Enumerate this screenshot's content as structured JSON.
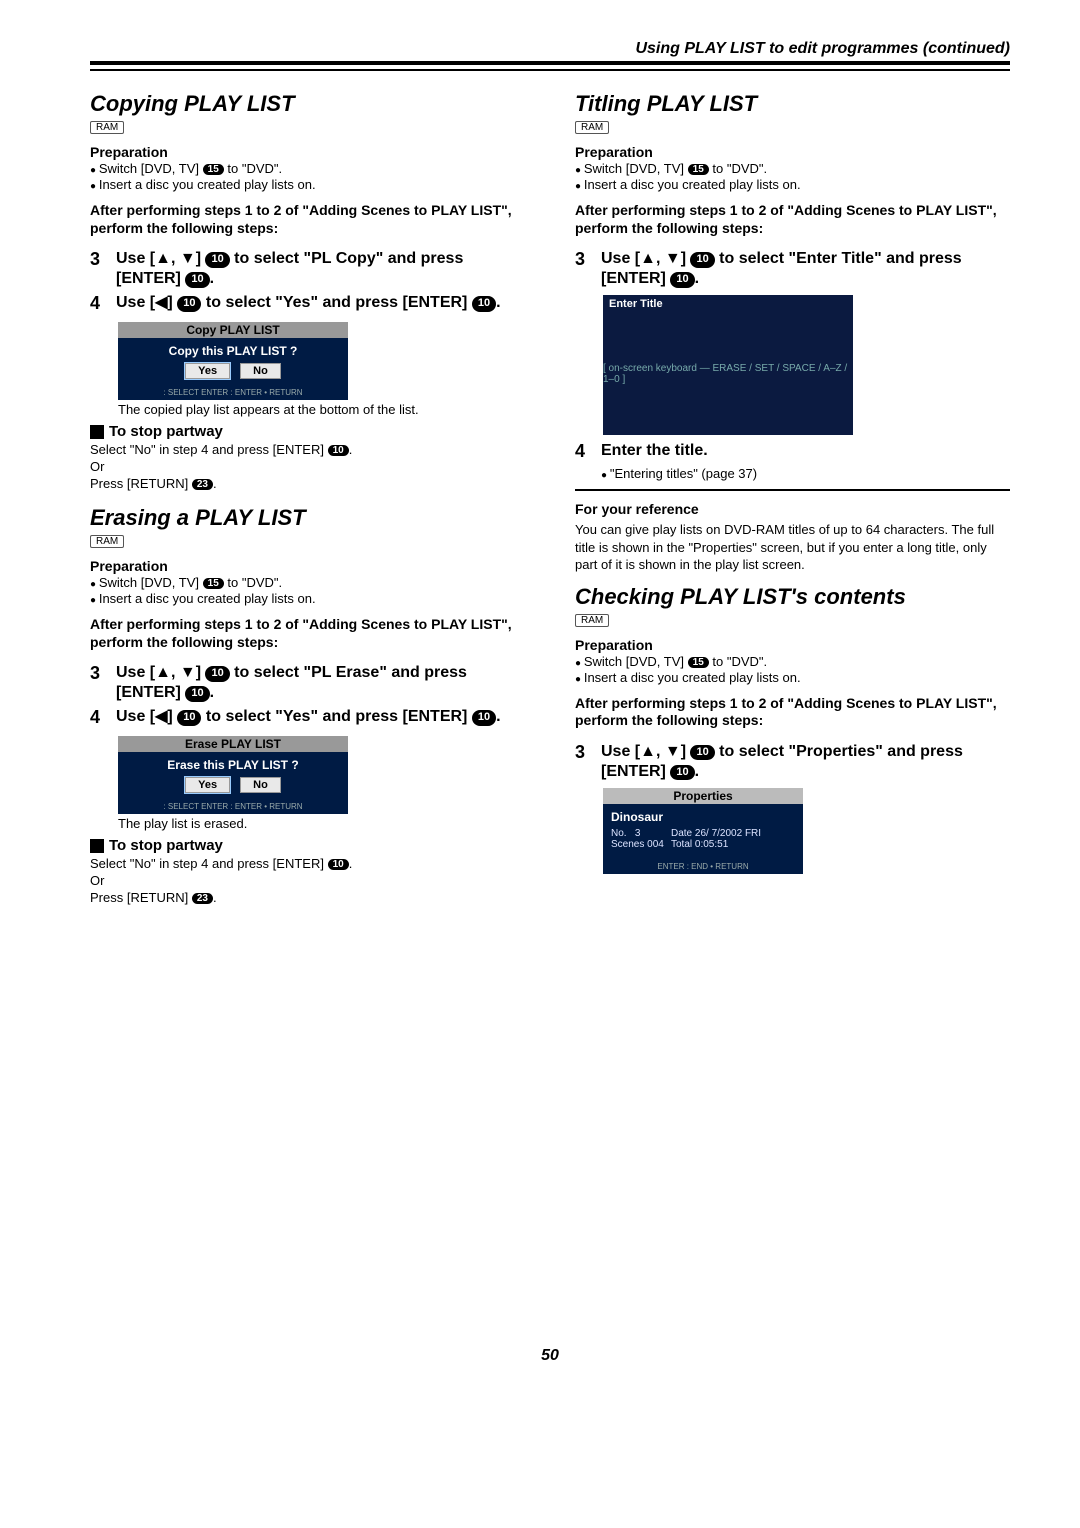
{
  "header": "Using PLAY LIST to edit programmes (continued)",
  "page_number": "50",
  "ram": "RAM",
  "prep_label": "Preparation",
  "prep1_a": "Switch [DVD, TV]",
  "prep1_badge": "15",
  "prep1_b": " to \"DVD\".",
  "prep2": "Insert a disc you created play lists on.",
  "after_steps": "After performing steps 1 to 2 of \"Adding Scenes to PLAY LIST\", perform the following steps:",
  "left": {
    "copy": {
      "title": "Copying PLAY LIST",
      "s3_a": "Use [▲, ▼] ",
      "s3_b": " to select \"PL Copy\" and press [ENTER] ",
      "s4_a": "Use [◀] ",
      "s4_b": " to select \"Yes\" and press [ENTER] ",
      "dlg_title": "Copy PLAY LIST",
      "dlg_msg": "Copy this PLAY LIST ?",
      "dlg_yes": "Yes",
      "dlg_no": "No",
      "dlg_foot": " : SELECT     ENTER : ENTER     • RETURN",
      "note": "The copied play list appears at the bottom of the list.",
      "stop_title": "To stop partway",
      "stop1": "Select \"No\" in step 4 and press [ENTER] ",
      "stop_or": "Or",
      "stop2": "Press [RETURN] ",
      "badge23": "23"
    },
    "erase": {
      "title": "Erasing a PLAY LIST",
      "s3_a": "Use [▲, ▼] ",
      "s3_b": " to select \"PL Erase\" and press [ENTER] ",
      "s4_a": "Use [◀] ",
      "s4_b": " to select \"Yes\" and press [ENTER] ",
      "dlg_title": "Erase PLAY LIST",
      "dlg_msg": "Erase this PLAY LIST ?",
      "dlg_yes": "Yes",
      "dlg_no": "No",
      "note": "The play list is erased.",
      "stop_title": "To stop partway",
      "stop1": "Select \"No\" in step 4 and press [ENTER] ",
      "stop_or": "Or",
      "stop2": "Press [RETURN] ",
      "badge23": "23"
    }
  },
  "right": {
    "titling": {
      "title": "Titling PLAY LIST",
      "s3_a": "Use [▲, ▼] ",
      "s3_b": " to select \"Enter Title\" and press [ENTER] ",
      "enter_title_bar": "Enter Title",
      "keyboard_note": "[ on-screen keyboard — ERASE / SET / SPACE / A–Z / 1–0 ]",
      "s4_num": "4",
      "s4": "Enter the title.",
      "s4_sub": "\"Entering titles\" (page 37)",
      "ref_title": "For your reference",
      "ref_body": "You can give play lists on DVD-RAM titles of up to 64 characters. The full title is shown in the \"Properties\" screen, but if you enter a long title, only part of it is shown in the play list screen."
    },
    "check": {
      "title": "Checking PLAY LIST's contents",
      "s3_a": "Use [▲, ▼] ",
      "s3_b": " to select \"Properties\" and press [ENTER] ",
      "props_bar": "Properties",
      "props_name": "Dinosaur",
      "props_no_l": "No.",
      "props_no_v": "3",
      "props_date_l": "Date",
      "props_date_v": "26/ 7/2002 FRI",
      "props_sc_l": "Scenes",
      "props_sc_v": "004",
      "props_tot_l": "Total",
      "props_tot_v": "0:05:51",
      "props_foot": "ENTER : END   • RETURN"
    }
  },
  "n3": "3",
  "n4": "4",
  "b10": "10",
  "dot": "."
}
